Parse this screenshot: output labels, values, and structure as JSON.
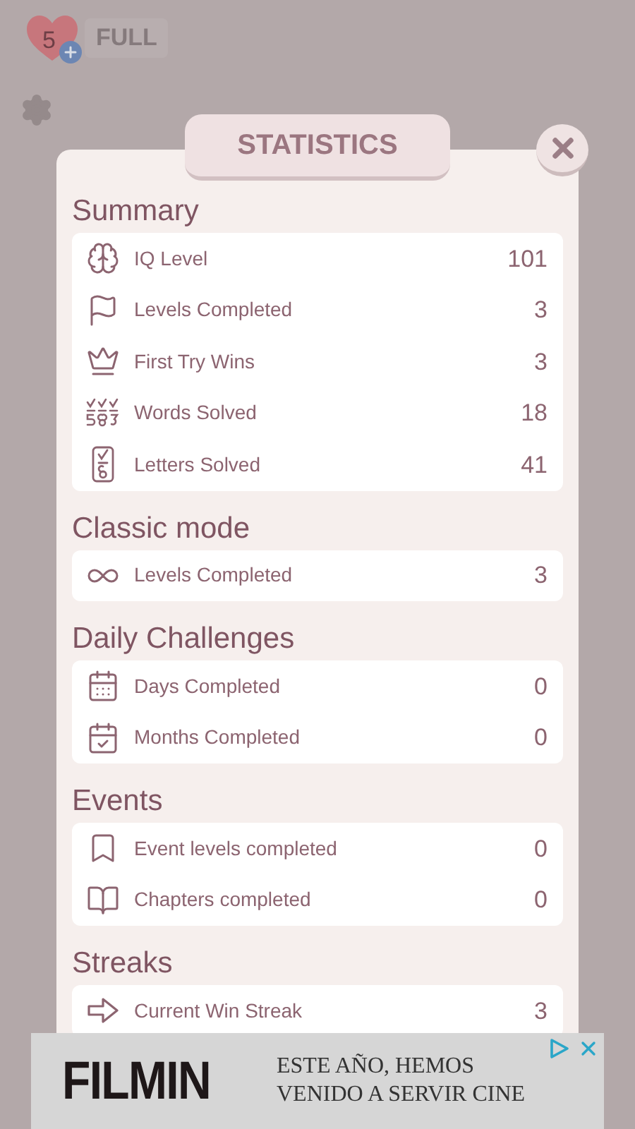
{
  "lives": {
    "count": "5",
    "status": "FULL"
  },
  "dialog": {
    "title": "STATISTICS"
  },
  "sections": [
    {
      "title": "Summary",
      "rows": [
        {
          "kind": "brain",
          "label": "IQ Level",
          "value": "101"
        },
        {
          "kind": "flag",
          "label": "Levels Completed",
          "value": "3"
        },
        {
          "kind": "crown",
          "label": "First Try Wins",
          "value": "3"
        },
        {
          "kind": "words",
          "label": "Words Solved",
          "value": "18"
        },
        {
          "kind": "letter",
          "label": "Letters Solved",
          "value": "41"
        }
      ]
    },
    {
      "title": "Classic mode",
      "rows": [
        {
          "kind": "infinity",
          "label": "Levels Completed",
          "value": "3"
        }
      ]
    },
    {
      "title": "Daily Challenges",
      "rows": [
        {
          "kind": "calendar",
          "label": "Days Completed",
          "value": "0"
        },
        {
          "kind": "calendarcheck",
          "label": "Months Completed",
          "value": "0"
        }
      ]
    },
    {
      "title": "Events",
      "rows": [
        {
          "kind": "bookmark",
          "label": "Event levels completed",
          "value": "0"
        },
        {
          "kind": "book",
          "label": "Chapters completed",
          "value": "0"
        }
      ]
    },
    {
      "title": "Streaks",
      "rows": [
        {
          "kind": "arrow",
          "label": "Current Win Streak",
          "value": "3"
        }
      ]
    }
  ],
  "ad": {
    "brand": "FILMIN",
    "line_1": "ESTE AÑO, HEMOS",
    "line_2": "VENIDO A SERVIR CINE"
  }
}
